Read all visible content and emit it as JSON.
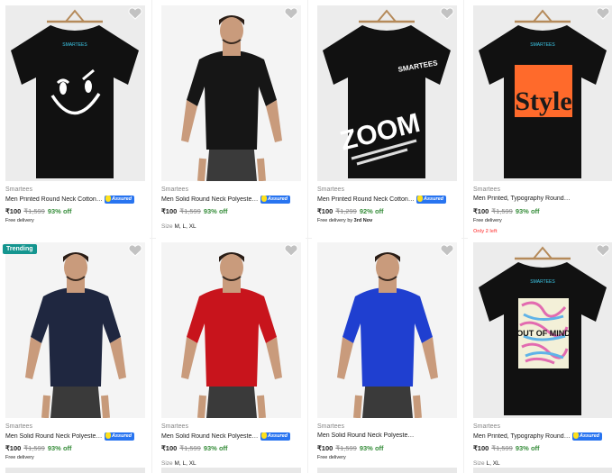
{
  "products": [
    {
      "brand": "Smartees",
      "title": "Men Printed Round Neck Cotton Black T-Shirt",
      "price": "₹100",
      "mrp": "₹1,599",
      "off": "93% off",
      "assured": "Assured",
      "delivery": "Free delivery",
      "delivery_date": "",
      "sizes": "",
      "stock": "",
      "badge": "",
      "shirt_color": "#111111",
      "print": "smiley"
    },
    {
      "brand": "Smartees",
      "title": "Men Solid Round Neck Polyester Black T-Shirt",
      "price": "₹100",
      "mrp": "₹1,599",
      "off": "93% off",
      "assured": "Assured",
      "delivery": "",
      "delivery_date": "",
      "sizes": "M, L, XL",
      "stock": "",
      "badge": "",
      "shirt_color": "#161616",
      "print": "model"
    },
    {
      "brand": "Smartees",
      "title": "Men Printed Round Neck Cotton Black T-Shirt",
      "price": "₹100",
      "mrp": "₹1,299",
      "off": "92% off",
      "assured": "Assured",
      "delivery": "Free delivery by",
      "delivery_date": "3rd Nov",
      "sizes": "",
      "stock": "",
      "badge": "",
      "shirt_color": "#111111",
      "print": "zoom"
    },
    {
      "brand": "Smartees",
      "title": "Men Printed, Typography Round Neck Cotton Black T-Shirt",
      "price": "₹100",
      "mrp": "₹1,599",
      "off": "93% off",
      "assured": "",
      "delivery": "Free delivery",
      "delivery_date": "",
      "sizes": "",
      "stock": "Only 2 left",
      "badge": "",
      "shirt_color": "#111111",
      "print": "style"
    },
    {
      "brand": "Smartees",
      "title": "Men Solid Round Neck Polyester Navy Blue T-Shirt",
      "price": "₹100",
      "mrp": "₹1,599",
      "off": "93% off",
      "assured": "Assured",
      "delivery": "Free delivery",
      "delivery_date": "",
      "sizes": "",
      "stock": "",
      "badge": "Trending",
      "shirt_color": "#1f2740",
      "print": "model"
    },
    {
      "brand": "Smartees",
      "title": "Men Solid Round Neck Polyester Red T-Shirt",
      "price": "₹100",
      "mrp": "₹1,599",
      "off": "93% off",
      "assured": "Assured",
      "delivery": "",
      "delivery_date": "",
      "sizes": "M, L, XL",
      "stock": "",
      "badge": "",
      "shirt_color": "#c8141c",
      "print": "model"
    },
    {
      "brand": "Smartees",
      "title": "Men Solid Round Neck Polyester Blue T-Shirt",
      "price": "₹100",
      "mrp": "₹1,599",
      "off": "93% off",
      "assured": "",
      "delivery": "Free delivery",
      "delivery_date": "",
      "sizes": "",
      "stock": "",
      "badge": "",
      "shirt_color": "#1f3fd0",
      "print": "model"
    },
    {
      "brand": "Smartees",
      "title": "Men Printed, Typography Round Neck Cotton Black T-Shirt",
      "price": "₹100",
      "mrp": "₹1,599",
      "off": "93% off",
      "assured": "Assured",
      "delivery": "",
      "delivery_date": "",
      "sizes": "L, XL",
      "stock": "",
      "badge": "",
      "shirt_color": "#111111",
      "print": "outofmind"
    }
  ],
  "labels": {
    "size_prefix": "Size",
    "logo_text": "SMARTEES",
    "zoom_text": "ZOOM",
    "style_text": "Style",
    "mind_text": "OUT OF MIND"
  },
  "colors": {
    "green": "#388e3c",
    "blue": "#2874f0",
    "trending": "#14958f",
    "stock": "#ff6161"
  }
}
